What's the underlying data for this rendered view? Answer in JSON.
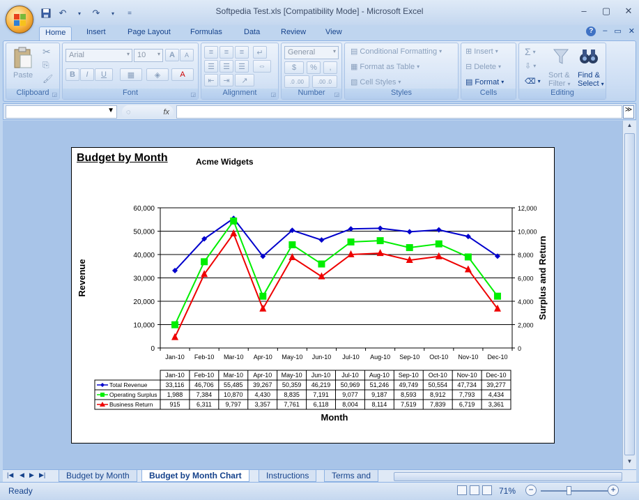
{
  "window": {
    "title": "Softpedia Test.xls  [Compatibility Mode] - Microsoft Excel",
    "controls": [
      "–",
      "▢",
      "✕"
    ],
    "help_controls": [
      "?",
      "–",
      "▭",
      "✕"
    ]
  },
  "qat": {
    "dropdown": "="
  },
  "tabs": [
    "Home",
    "Insert",
    "Page Layout",
    "Formulas",
    "Data",
    "Review",
    "View"
  ],
  "ribbon": {
    "clipboard": {
      "label": "Clipboard",
      "paste": "Paste"
    },
    "font": {
      "label": "Font",
      "name": "Arial",
      "size": "10",
      "bold": "B",
      "italic": "I",
      "underline": "U",
      "grow": "A",
      "shrink": "A"
    },
    "alignment": {
      "label": "Alignment"
    },
    "number": {
      "label": "Number",
      "format": "General",
      "currency": "$",
      "percent": "%",
      "comma": ",",
      "inc_dec": ".0 .00",
      "dec_dec": ".00 .0"
    },
    "styles": {
      "label": "Styles",
      "conditional": "Conditional Formatting",
      "table": "Format as Table",
      "cell": "Cell Styles"
    },
    "cells": {
      "label": "Cells",
      "insert": "Insert",
      "delete": "Delete",
      "format": "Format"
    },
    "editing": {
      "label": "Editing",
      "sum": "Σ",
      "sort": "Sort &",
      "filter": "Filter",
      "find": "Find &",
      "select": "Select"
    }
  },
  "formula_bar": {
    "name_box": "",
    "fx": "fx",
    "value": ""
  },
  "chart": {
    "title": "Budget by Month",
    "subtitle": "Acme Widgets",
    "y_left_label": "Revenue",
    "y_right_label": "Surplus and Return",
    "x_label": "Month",
    "y_left_ticks": [
      "60,000",
      "50,000",
      "40,000",
      "30,000",
      "20,000",
      "10,000",
      "0"
    ],
    "y_right_ticks": [
      "12,000",
      "10,000",
      "8,000",
      "6,000",
      "4,000",
      "2,000",
      "0"
    ],
    "table_rows": [
      [
        "33,116",
        "46,706",
        "55,485",
        "39,267",
        "50,359",
        "46,219",
        "50,969",
        "51,246",
        "49,749",
        "50,554",
        "47,734",
        "39,277"
      ],
      [
        "1,988",
        "7,384",
        "10,870",
        "4,430",
        "8,835",
        "7,191",
        "9,077",
        "9,187",
        "8,593",
        "8,912",
        "7,793",
        "4,434"
      ],
      [
        "915",
        "6,311",
        "9,797",
        "3,357",
        "7,761",
        "6,118",
        "8,004",
        "8,114",
        "7,519",
        "7,839",
        "6,719",
        "3,361"
      ]
    ]
  },
  "chart_data": {
    "type": "line",
    "title": "Budget by Month",
    "subtitle": "Acme Widgets",
    "xlabel": "Month",
    "ylabel": "Revenue",
    "y2label": "Surplus and Return",
    "categories": [
      "Jan-10",
      "Feb-10",
      "Mar-10",
      "Apr-10",
      "May-10",
      "Jun-10",
      "Jul-10",
      "Aug-10",
      "Sep-10",
      "Oct-10",
      "Nov-10",
      "Dec-10"
    ],
    "ylim": [
      0,
      60000
    ],
    "y2lim": [
      0,
      12000
    ],
    "grid": true,
    "series": [
      {
        "name": "Total Revenue",
        "axis": "left",
        "color": "#0000cc",
        "marker": "diamond",
        "values": [
          33116,
          46706,
          55485,
          39267,
          50359,
          46219,
          50969,
          51246,
          49749,
          50554,
          47734,
          39277
        ]
      },
      {
        "name": "Operating Surplus",
        "axis": "right",
        "color": "#00ee00",
        "marker": "square",
        "values": [
          1988,
          7384,
          10870,
          4430,
          8835,
          7191,
          9077,
          9187,
          8593,
          8912,
          7793,
          4434
        ]
      },
      {
        "name": "Business Return",
        "axis": "right",
        "color": "#ee0000",
        "marker": "triangle",
        "values": [
          915,
          6311,
          9797,
          3357,
          7761,
          6118,
          8004,
          8114,
          7519,
          7839,
          6719,
          3361
        ]
      }
    ]
  },
  "sheet_tabs": [
    "Budget by Month",
    "Budget by Month Chart",
    "Instructions",
    "Terms and"
  ],
  "active_sheet": "Budget by Month Chart",
  "status": {
    "ready": "Ready",
    "zoom": "71%"
  }
}
